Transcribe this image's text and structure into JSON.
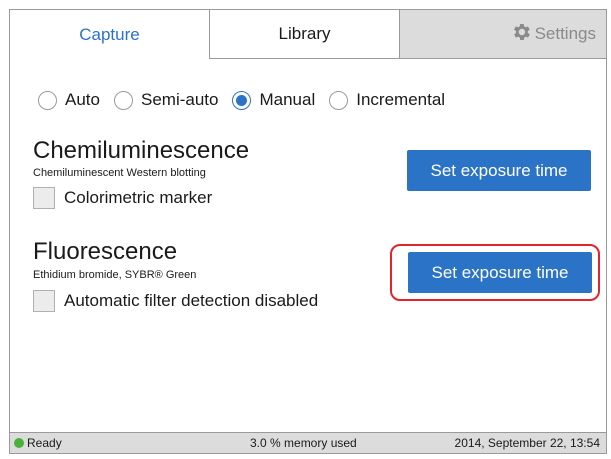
{
  "tabs": {
    "capture": "Capture",
    "library": "Library",
    "settings": "Settings"
  },
  "mode": {
    "options": [
      "Auto",
      "Semi-auto",
      "Manual",
      "Incremental"
    ],
    "selected": "Manual"
  },
  "chemiluminescence": {
    "title": "Chemiluminescence",
    "subtitle": "Chemiluminescent Western blotting",
    "checkbox_label": "Colorimetric marker",
    "checkbox_checked": false,
    "button_label": "Set exposure time"
  },
  "fluorescence": {
    "title": "Fluorescence",
    "subtitle": "Ethidium bromide, SYBR® Green",
    "checkbox_label": "Automatic filter detection disabled",
    "checkbox_checked": false,
    "button_label": "Set exposure time",
    "button_highlighted": true
  },
  "status": {
    "state": "Ready",
    "memory": "3.0 % memory used",
    "datetime": "2014, September 22, 13:54"
  },
  "colors": {
    "accent": "#2b73c6",
    "highlight": "#e0262c",
    "status_ok": "#4cb03c"
  }
}
